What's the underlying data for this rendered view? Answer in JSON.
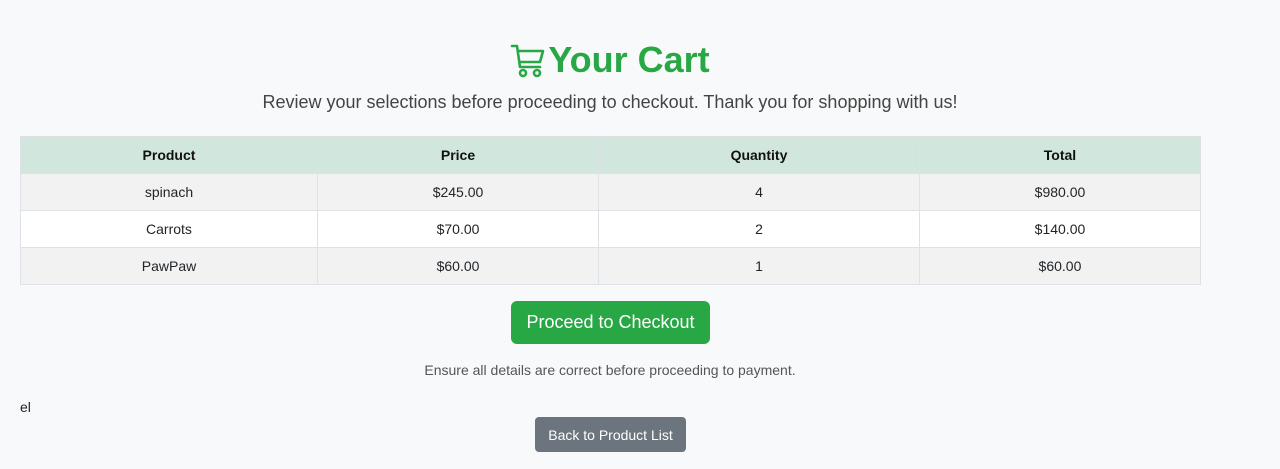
{
  "header": {
    "title": "Your Cart",
    "icon": "cart-icon",
    "subtitle": "Review your selections before proceeding to checkout. Thank you for shopping with us!"
  },
  "table": {
    "columns": [
      "Product",
      "Price",
      "Quantity",
      "Total"
    ],
    "rows": [
      {
        "product": "spinach",
        "price": "$245.00",
        "quantity": "4",
        "total": "$980.00"
      },
      {
        "product": "Carrots",
        "price": "$70.00",
        "quantity": "2",
        "total": "$140.00"
      },
      {
        "product": "PawPaw",
        "price": "$60.00",
        "quantity": "1",
        "total": "$60.00"
      }
    ]
  },
  "actions": {
    "checkout_label": "Proceed to Checkout",
    "note": "Ensure all details are correct before proceeding to payment.",
    "stray_text": "el",
    "back_label": "Back to Product List"
  },
  "colors": {
    "accent": "#28a745",
    "header_bg": "#d1e7dd",
    "secondary_button": "#6c757d"
  }
}
